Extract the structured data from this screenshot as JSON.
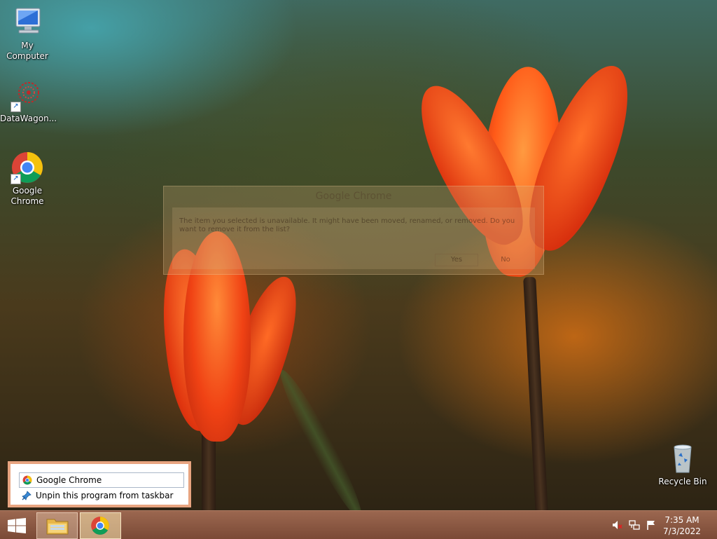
{
  "desktop": {
    "icons": [
      {
        "label": "My Computer",
        "icon": "computer-icon"
      },
      {
        "label": "DataWagon...",
        "icon": "datawagon-icon"
      },
      {
        "label": "Google Chrome",
        "icon": "chrome-icon"
      },
      {
        "label": "Recycle Bin",
        "icon": "recycle-bin-icon"
      }
    ]
  },
  "dialog": {
    "title": "Google Chrome",
    "message": "The item you selected is unavailable. It might have been moved, renamed, or removed. Do you want to remove it from the list?",
    "yes_label": "Yes",
    "no_label": "No"
  },
  "jumplist": {
    "items": [
      {
        "label": "Google Chrome",
        "icon": "chrome-icon"
      },
      {
        "label": "Unpin this program from taskbar",
        "icon": "unpin-icon"
      }
    ]
  },
  "taskbar": {
    "start_icon": "windows-logo-icon",
    "pinned": [
      {
        "name": "File Explorer",
        "icon": "folder-icon"
      },
      {
        "name": "Google Chrome",
        "icon": "chrome-icon"
      }
    ],
    "tray": [
      "volume-muted-icon",
      "network-icon",
      "action-center-flag-icon"
    ],
    "time": "7:35 AM",
    "date": "7/3/2022"
  },
  "colors": {
    "taskbar": "#8a5a44",
    "jumplist_border": "#e8a480",
    "tulip": "#ff5a20"
  }
}
